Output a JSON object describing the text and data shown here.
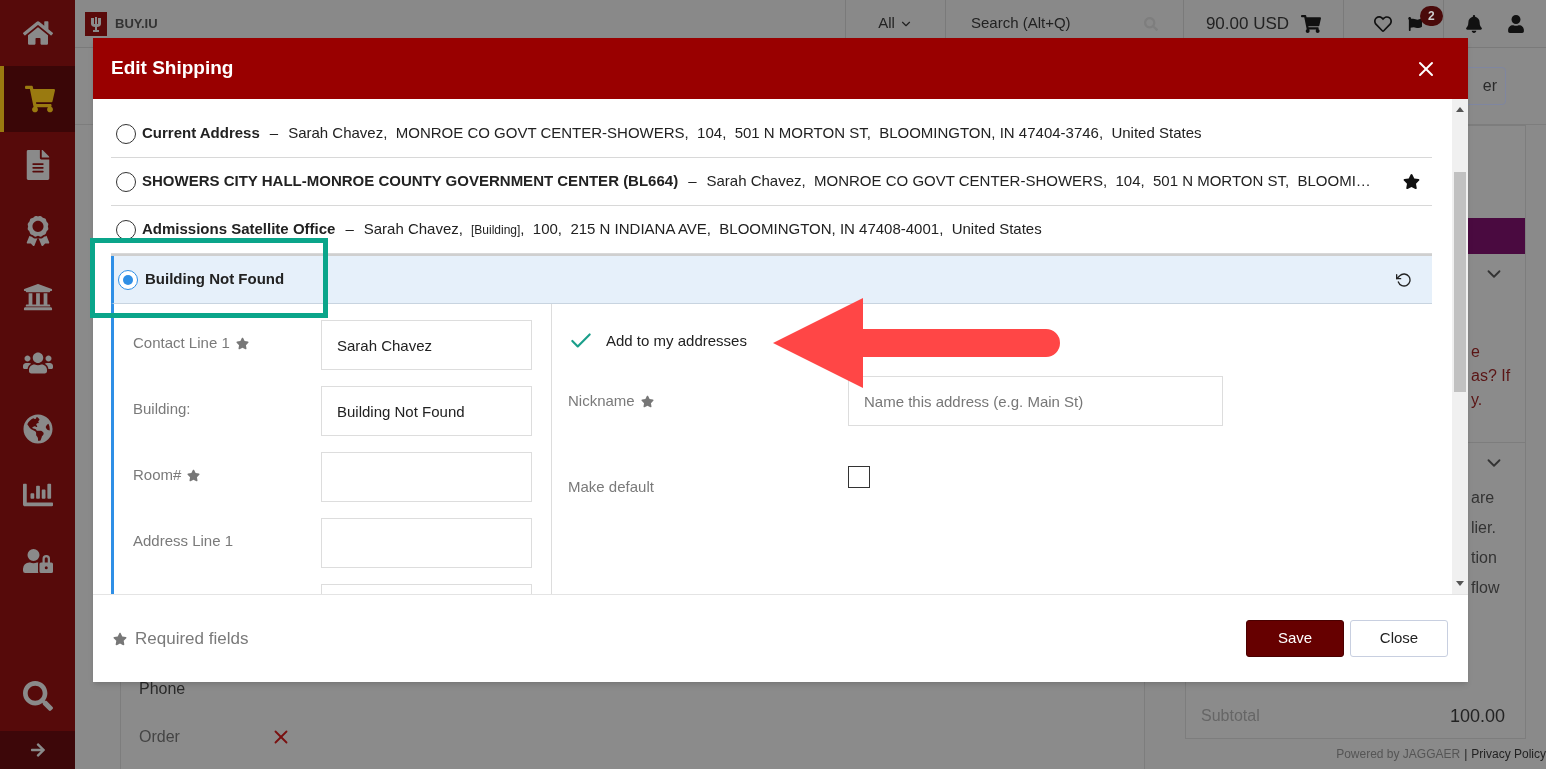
{
  "sidebar": {
    "items": [
      {
        "selected": false
      },
      {
        "selected": true
      },
      {
        "selected": false
      },
      {
        "selected": false
      },
      {
        "selected": false
      },
      {
        "selected": false
      },
      {
        "selected": false
      },
      {
        "selected": false
      },
      {
        "selected": false
      }
    ]
  },
  "topbar": {
    "logo_text": "BUY.IU",
    "search_scope": "All",
    "search_placeholder": "Search (Alt+Q)",
    "cart_total": "90.00 USD",
    "flag_badge": "2"
  },
  "background": {
    "toolbar_button": "er",
    "left_labels": [
      "Phone",
      "Order"
    ],
    "right_panel_texts": [
      "e",
      "as? If",
      "y.",
      "are",
      "lier.",
      "tion",
      "flow"
    ],
    "subtotal_label": "Subtotal",
    "subtotal_value": "100.00",
    "footer": {
      "powered_by": "Powered by JAGGAER",
      "separator": "|",
      "link": "Privacy Policy"
    }
  },
  "dialog": {
    "title": "Edit Shipping",
    "addresses": [
      {
        "label": "Current Address",
        "separator": "–",
        "starred": false,
        "selected": false,
        "parts": [
          {
            "kind": "text",
            "text": "Sarah Chavez,  MONROE CO GOVT CENTER-SHOWERS,  104,  501 N MORTON ST,  BLOOMINGTON, IN 47404-3746,  United States"
          }
        ]
      },
      {
        "label": "SHOWERS CITY HALL-MONROE COUNTY GOVERNMENT CENTER (BL664)",
        "separator": "–",
        "starred": true,
        "selected": false,
        "parts": [
          {
            "kind": "text",
            "text": "Sarah Chavez,  MONROE CO GOVT CENTER-SHOWERS,  104,  501 N MORTON ST,  BLOOMI…"
          }
        ]
      },
      {
        "label": "Admissions Satellite Office",
        "separator": "–",
        "starred": false,
        "selected": false,
        "parts": [
          {
            "kind": "text",
            "text": "Sarah Chavez,"
          },
          {
            "kind": "tag",
            "text": "[Building]"
          },
          {
            "kind": "text",
            "text": ",  100,  215 N INDIANA AVE,  BLOOMINGTON, IN 47408-4001,  United States"
          }
        ]
      },
      {
        "label": "Building Not Found",
        "starred": false,
        "selected": true
      }
    ],
    "form": {
      "fields": [
        {
          "label": "Contact Line 1",
          "required": true,
          "value": "Sarah Chavez"
        },
        {
          "label": "Building:",
          "required": false,
          "value": "Building Not Found"
        },
        {
          "label": "Room#",
          "required": true
        },
        {
          "label": "Address Line 1",
          "required": false
        }
      ],
      "add_to_addresses": {
        "label": "Add to my addresses",
        "checked": true
      },
      "nickname": {
        "label": "Nickname",
        "required": true,
        "placeholder": "Name this address (e.g. Main St)"
      },
      "make_default": {
        "label": "Make default",
        "checked": false
      }
    },
    "required_note": "Required fields",
    "buttons": [
      {
        "label": "Save",
        "kind": "primary"
      },
      {
        "label": "Close",
        "kind": "secondary"
      }
    ]
  }
}
